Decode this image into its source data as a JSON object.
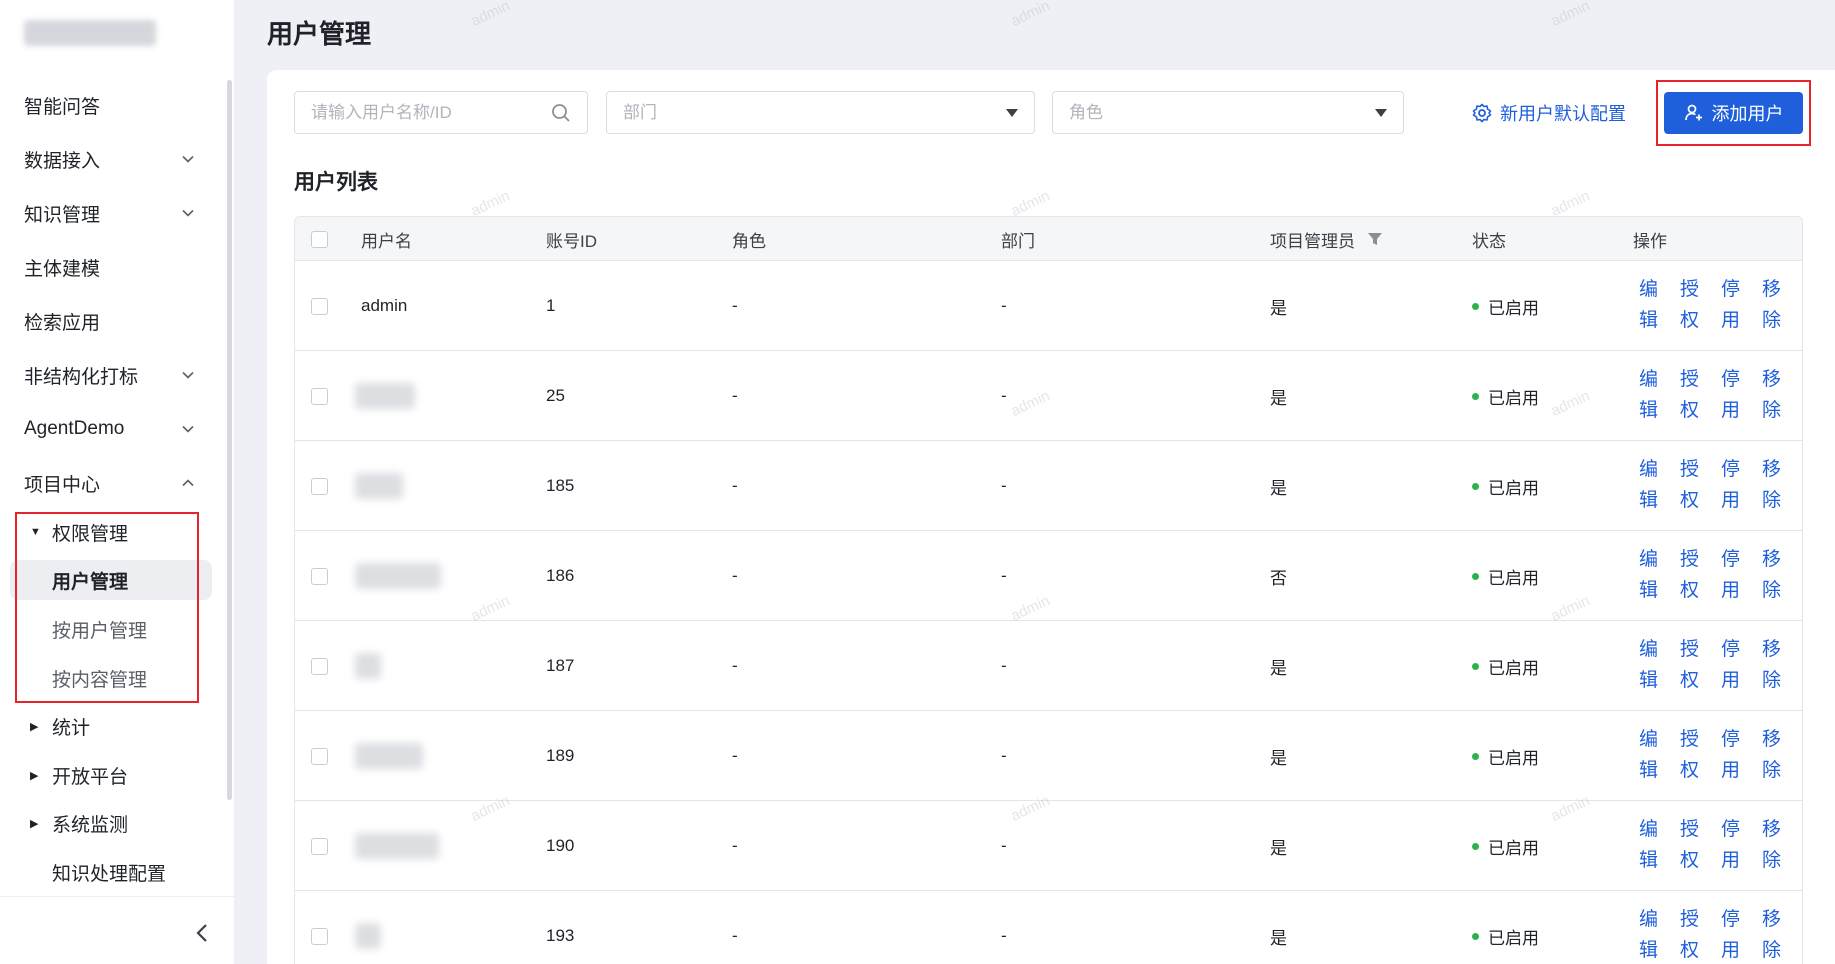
{
  "sidebar": {
    "items": [
      {
        "label": "智能问答",
        "chevron": "none"
      },
      {
        "label": "数据接入",
        "chevron": "down"
      },
      {
        "label": "知识管理",
        "chevron": "down"
      },
      {
        "label": "主体建模",
        "chevron": "none"
      },
      {
        "label": "检索应用",
        "chevron": "none"
      },
      {
        "label": "非结构化打标",
        "chevron": "down"
      },
      {
        "label": "AgentDemo",
        "chevron": "down"
      },
      {
        "label": "项目中心",
        "chevron": "up"
      }
    ],
    "sub": {
      "permission": "权限管理",
      "user_management": "用户管理",
      "by_user": "按用户管理",
      "by_content": "按内容管理",
      "stats": "统计",
      "open_platform": "开放平台",
      "system_monitor": "系统监测",
      "knowledge_config": "知识处理配置"
    }
  },
  "page": {
    "title": "用户管理",
    "section_title": "用户列表",
    "watermark": "admin"
  },
  "filters": {
    "search_placeholder": "请输入用户名称/ID",
    "dept_placeholder": "部门",
    "role_placeholder": "角色"
  },
  "actions": {
    "default_config": "新用户默认配置",
    "add_user": "添加用户"
  },
  "table": {
    "headers": {
      "username": "用户名",
      "account_id": "账号ID",
      "role": "角色",
      "dept": "部门",
      "project_admin": "项目管理员",
      "status": "状态",
      "ops": "操作"
    },
    "op_labels": [
      "编",
      "授",
      "停",
      "移",
      "辑",
      "权",
      "用",
      "除"
    ],
    "rows": [
      {
        "username": "admin",
        "id": "1",
        "role": "-",
        "dept": "-",
        "admin": "是",
        "status": "已启用"
      },
      {
        "username": "",
        "id": "25",
        "role": "-",
        "dept": "-",
        "admin": "是",
        "status": "已启用"
      },
      {
        "username": "",
        "id": "185",
        "role": "-",
        "dept": "-",
        "admin": "是",
        "status": "已启用"
      },
      {
        "username": "",
        "id": "186",
        "role": "-",
        "dept": "-",
        "admin": "否",
        "status": "已启用"
      },
      {
        "username": "",
        "id": "187",
        "role": "-",
        "dept": "-",
        "admin": "是",
        "status": "已启用"
      },
      {
        "username": "",
        "id": "189",
        "role": "-",
        "dept": "-",
        "admin": "是",
        "status": "已启用"
      },
      {
        "username": "",
        "id": "190",
        "role": "-",
        "dept": "-",
        "admin": "是",
        "status": "已启用"
      },
      {
        "username": "",
        "id": "193",
        "role": "-",
        "dept": "-",
        "admin": "是",
        "status": "已启用"
      }
    ]
  },
  "colors": {
    "accent": "#1f5fdc",
    "status_ok": "#2bb24c",
    "highlight": "#e5242b"
  }
}
